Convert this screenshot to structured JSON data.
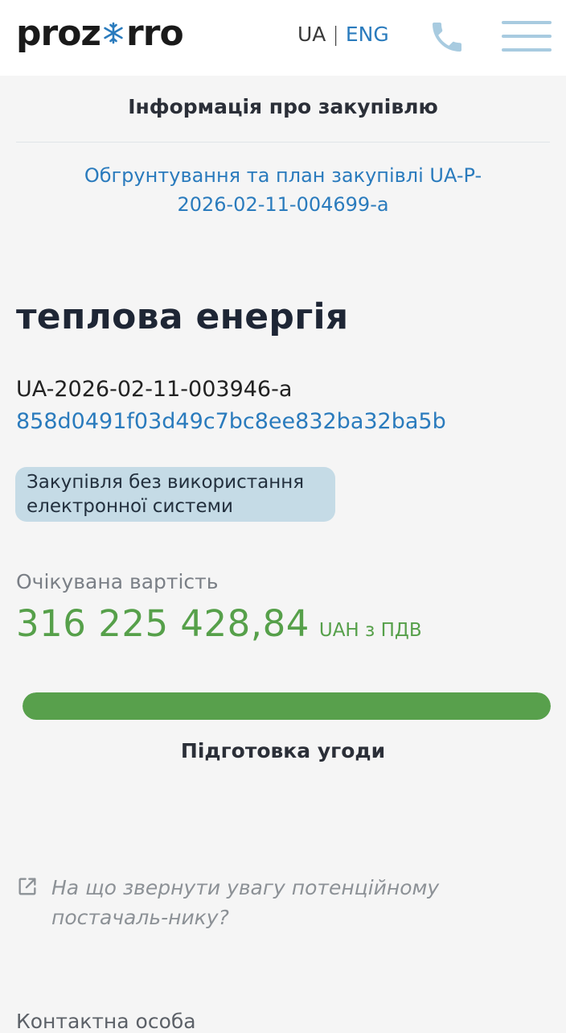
{
  "header": {
    "logo_left": "proz",
    "logo_right": "rro",
    "lang_ua": "UA",
    "lang_separator": "|",
    "lang_eng": "ENG",
    "icons": [
      "snowflake-icon",
      "phone-icon",
      "menu-icon"
    ]
  },
  "info_title": "Інформація про закупівлю",
  "plan_link": "Обгрунтування та план закупівлі UA-P-2026-02-11-004699-a",
  "tender": {
    "title": "теплова енергія",
    "id": "UA-2026-02-11-003946-a",
    "hash": "858d0491f03d49c7bc8ee832ba32ba5b",
    "badge": "Закупівля без використання електронної системи"
  },
  "expected": {
    "label": "Очікувана вартість",
    "amount": "316 225 428,84",
    "currency": "UAH з ПДВ"
  },
  "progress": {
    "fraction": 1.0,
    "status": "Підготовка угоди"
  },
  "attention_link": "На що звернути увагу потенційному постачаль-нику?",
  "contact_label": "Контактна особа",
  "colors": {
    "link": "#2a7bbd",
    "value_green": "#56a04a",
    "progress_green": "#58a04c",
    "badge_bg": "#c5dbe6"
  }
}
